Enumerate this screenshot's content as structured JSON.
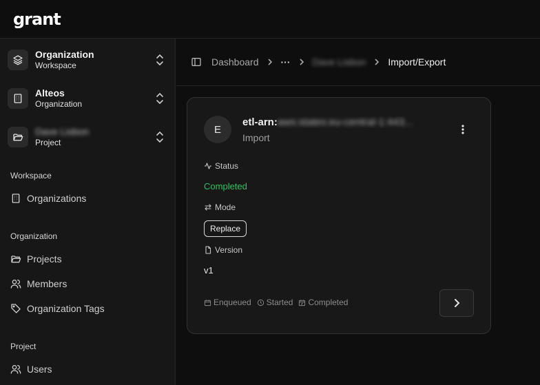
{
  "app": {
    "logo": "grant"
  },
  "switchers": [
    {
      "title": "Organization",
      "subtitle": "Workspace",
      "icon": "layers-icon"
    },
    {
      "title": "Alteos",
      "subtitle": "Organization",
      "icon": "building-icon"
    },
    {
      "title": "Dave Lisbon",
      "subtitle": "Project",
      "icon": "folder-open-icon"
    }
  ],
  "sidebar": {
    "sections": [
      {
        "label": "Workspace",
        "items": [
          {
            "label": "Organizations",
            "icon": "building-icon"
          }
        ]
      },
      {
        "label": "Organization",
        "items": [
          {
            "label": "Projects",
            "icon": "folder-open-icon"
          },
          {
            "label": "Members",
            "icon": "users-icon"
          },
          {
            "label": "Organization Tags",
            "icon": "tag-icon"
          }
        ]
      },
      {
        "label": "Project",
        "items": [
          {
            "label": "Users",
            "icon": "users-icon"
          }
        ]
      }
    ]
  },
  "breadcrumb": {
    "root": "Dashboard",
    "ellipsis": "···",
    "project": "Dave Lisbon",
    "current": "Import/Export"
  },
  "card": {
    "avatar": "E",
    "title_prefix": "etl-arn:",
    "title_rest": "aws:states:eu-central-1:443...",
    "subtitle": "Import",
    "status_label": "Status",
    "status_value": "Completed",
    "mode_label": "Mode",
    "mode_value": "Replace",
    "version_label": "Version",
    "version_value": "v1",
    "timeline": {
      "enqueued": "Enqueued",
      "started": "Started",
      "completed": "Completed"
    }
  },
  "colors": {
    "success": "#22c55e",
    "background": "#0e0e0e",
    "sidebar": "#171717",
    "card": "#181818"
  }
}
